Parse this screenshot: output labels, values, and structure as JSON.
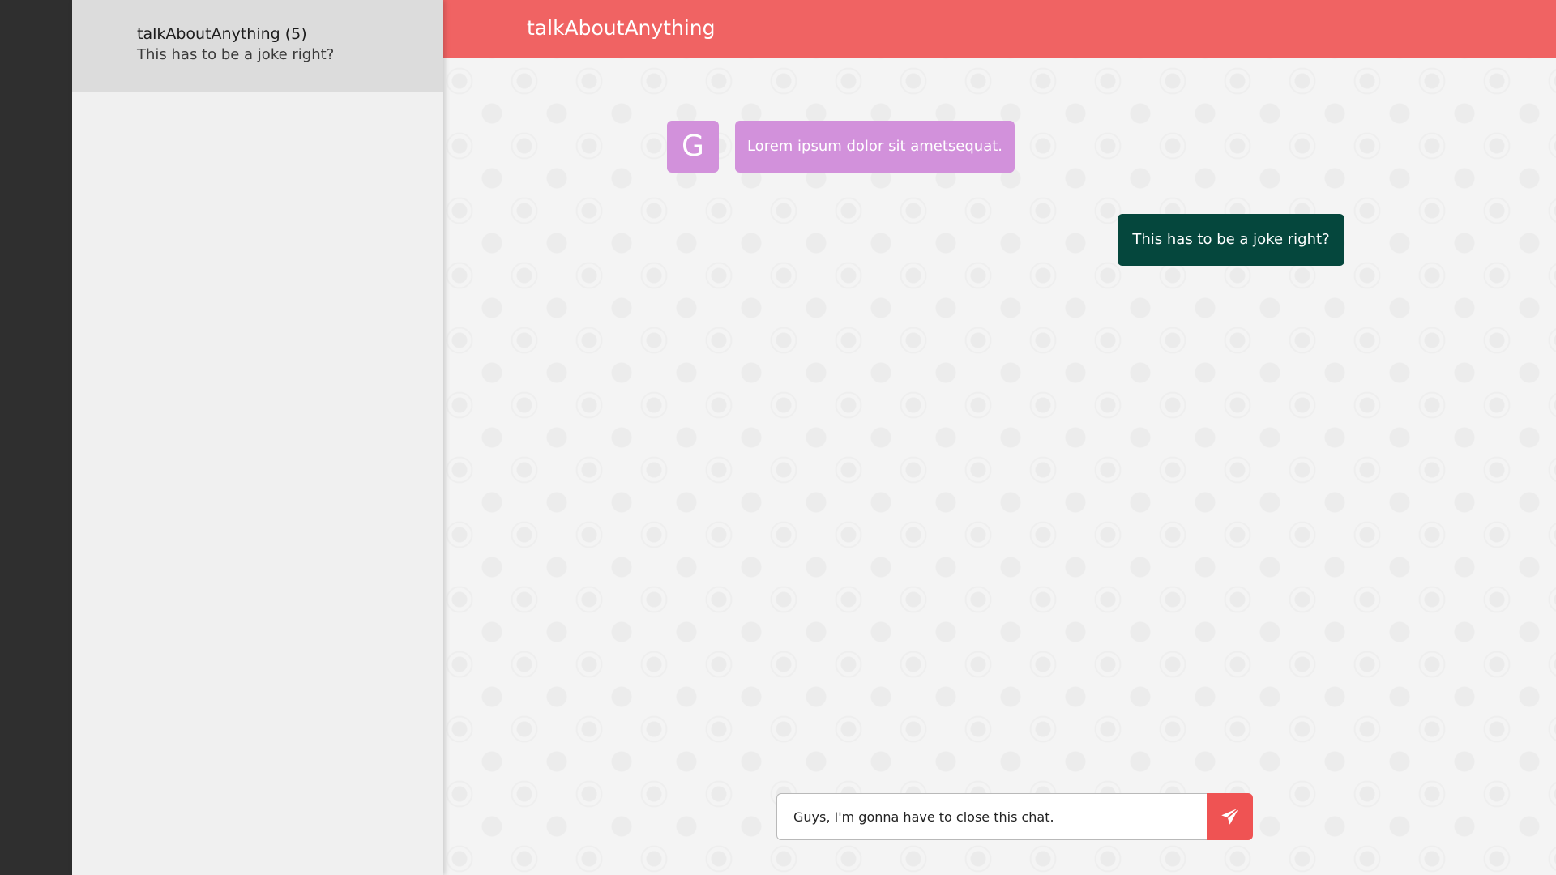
{
  "sidebar": {
    "chats": [
      {
        "title": "talkAboutAnything (5)",
        "preview": "This has to be a joke right?"
      }
    ]
  },
  "header": {
    "title": "talkAboutAnything"
  },
  "messages": [
    {
      "direction": "incoming",
      "avatar_initial": "G",
      "text": "Lorem ipsum dolor sit ametsequat."
    },
    {
      "direction": "outgoing",
      "text": "This has to be a joke right?"
    }
  ],
  "composer": {
    "value": "Guys, I'm gonna have to close this chat.",
    "send_icon": "paper-plane-icon"
  },
  "colors": {
    "header": "#f06363",
    "incoming_bubble": "#d291db",
    "outgoing_bubble": "#05473d",
    "send_button": "#ef5353"
  }
}
